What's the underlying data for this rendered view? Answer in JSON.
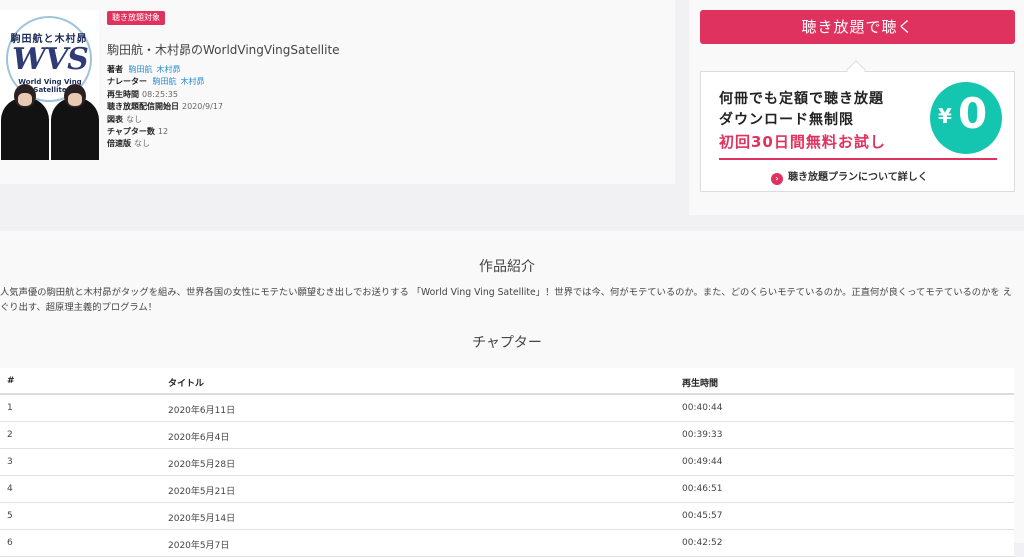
{
  "book": {
    "badge": "聴き放題対象",
    "cover_title_line": "駒田航と木村昴",
    "cover_logo": "WVS",
    "cover_subtitle": "World Ving Ving Satellite",
    "title": "駒田航・木村昴のWorldVingVingSatellite",
    "meta": {
      "author_label": "著者",
      "authors": [
        "駒田航",
        "木村昴"
      ],
      "narrator_label": "ナレーター",
      "narrators": [
        "駒田航",
        "木村昴"
      ],
      "duration_label": "再生時間",
      "duration": "08:25:35",
      "start_label": "聴き放題配信開始日",
      "start": "2020/9/17",
      "illustration_label": "図表",
      "illustration": "なし",
      "chapters_label": "チャプター数",
      "chapters": "12",
      "speed_label": "倍速版",
      "speed": "なし"
    }
  },
  "purchase": {
    "button_label": "聴き放題で聴く",
    "promo_line1": "何冊でも定額で聴き放題",
    "promo_line2": "ダウンロード無制限",
    "promo_line3": "初回30日間無料お試し",
    "promo_circle_yen": "¥",
    "promo_circle_zero": "0",
    "more_icon": "›",
    "more_link": "聴き放題プランについて詳しく",
    "accent_color": "#e0325e",
    "circle_color": "#14c6b0"
  },
  "intro": {
    "heading": "作品紹介",
    "text": "人気声優の駒田航と木村昴がタッグを組み、世界各国の女性にモテたい願望むき出しでお送りする 「World Ving Ving Satellite」！世界では今、何がモテているのか。また、どのくらいモテているのか。正直何が良くってモテているのかを えぐり出す、超原理主義的プログラム！"
  },
  "chapters": {
    "heading": "チャプター",
    "columns": [
      "#",
      "タイトル",
      "再生時間"
    ],
    "rows": [
      [
        "1",
        "2020年6月11日",
        "00:40:44"
      ],
      [
        "2",
        "2020年6月4日",
        "00:39:33"
      ],
      [
        "3",
        "2020年5月28日",
        "00:49:44"
      ],
      [
        "4",
        "2020年5月21日",
        "00:46:51"
      ],
      [
        "5",
        "2020年5月14日",
        "00:45:57"
      ],
      [
        "6",
        "2020年5月7日",
        "00:42:52"
      ]
    ]
  }
}
